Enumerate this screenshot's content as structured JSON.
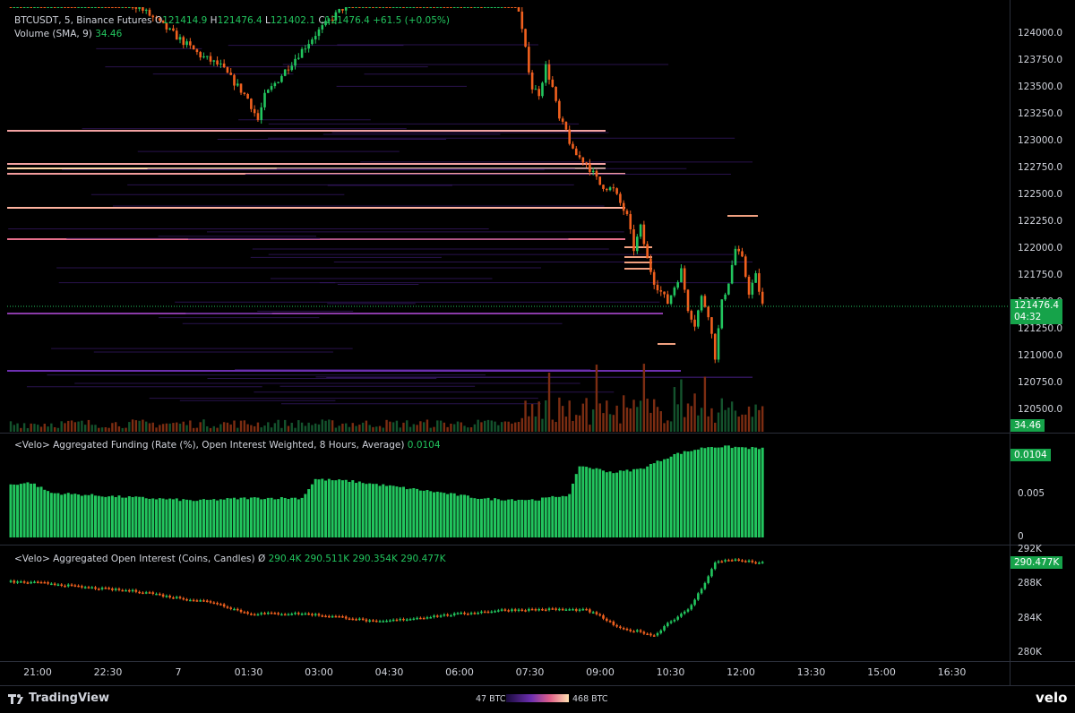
{
  "colors": {
    "up": "#22c55e",
    "down": "#f0601e",
    "background": "#000000",
    "grid": "#2a2e39",
    "last_price_line": "#22c55e"
  },
  "header": {
    "symbol": "BTCUSDT",
    "interval": "5",
    "exchange": "Binance Futures",
    "o_label": "O",
    "o_value": "121414.9",
    "h_label": "H",
    "h_value": "121476.4",
    "l_label": "L",
    "l_value": "121402.1",
    "c_label": "C",
    "c_value": "121476.4",
    "change": "+61.5 (+0.05%)",
    "volume_label": "Volume (SMA, 9)",
    "volume_value": "34.46"
  },
  "funding_panel": {
    "title": "<Velo> Aggregated Funding (Rate (%), Open Interest Weighted, 8 Hours, Average)",
    "value": "0.0104"
  },
  "oi_panel": {
    "title": "<Velo> Aggregated Open Interest (Coins, Candles)",
    "symbol": "Ø",
    "o": "290.4K",
    "h": "290.511K",
    "l": "290.354K",
    "c": "290.477K"
  },
  "price_tags": {
    "last_price": "121476.4",
    "countdown": "04:32",
    "volume": "34.46",
    "funding": "0.0104",
    "oi": "290.477K"
  },
  "heatmap_legend": {
    "min_label": "47 BTC",
    "max_label": "468 BTC"
  },
  "branding": {
    "left": "TradingView",
    "right": "velo"
  },
  "chart_data": [
    {
      "type": "candlestick",
      "title": "BTCUSDT, 5, Binance Futures",
      "ylim": [
        120420,
        124250
      ],
      "y_ticks": [
        "124000.0",
        "123750.0",
        "123500.0",
        "123250.0",
        "123000.0",
        "122750.0",
        "122500.0",
        "122250.0",
        "122000.0",
        "121750.0",
        "121500.0",
        "121250.0",
        "121000.0",
        "120750.0",
        "120500.0"
      ],
      "x_ticks": [
        "21:00",
        "22:30",
        "7",
        "01:30",
        "03:00",
        "04:30",
        "06:00",
        "07:30",
        "09:00",
        "10:30",
        "12:00",
        "13:30",
        "15:00",
        "16:30"
      ],
      "price_path": [
        [
          0,
          124400
        ],
        [
          28,
          124450
        ],
        [
          40,
          124200
        ],
        [
          50,
          123950
        ],
        [
          56,
          123800
        ],
        [
          62,
          123700
        ],
        [
          70,
          123400
        ],
        [
          73,
          123200
        ],
        [
          75,
          123420
        ],
        [
          82,
          123700
        ],
        [
          90,
          124000
        ],
        [
          100,
          124300
        ],
        [
          115,
          124400
        ],
        [
          130,
          124350
        ],
        [
          146,
          124600
        ],
        [
          150,
          124200
        ],
        [
          154,
          123500
        ],
        [
          156,
          123450
        ],
        [
          158,
          123700
        ],
        [
          160,
          123500
        ],
        [
          162,
          123200
        ],
        [
          164,
          123100
        ],
        [
          166,
          122900
        ],
        [
          170,
          122800
        ],
        [
          174,
          122600
        ],
        [
          178,
          122550
        ],
        [
          182,
          122300
        ],
        [
          184,
          122000
        ],
        [
          186,
          122200
        ],
        [
          188,
          121900
        ],
        [
          190,
          121700
        ],
        [
          194,
          121500
        ],
        [
          196,
          121650
        ],
        [
          198,
          121800
        ],
        [
          200,
          121450
        ],
        [
          202,
          121300
        ],
        [
          204,
          121550
        ],
        [
          206,
          121400
        ],
        [
          208,
          121000
        ],
        [
          210,
          121500
        ],
        [
          212,
          121700
        ],
        [
          214,
          122000
        ],
        [
          216,
          121900
        ],
        [
          218,
          121600
        ],
        [
          220,
          121750
        ],
        [
          222,
          121476
        ]
      ],
      "last_price": 121476.4
    },
    {
      "type": "bar",
      "title": "<Velo> Aggregated Funding (Rate (%), Open Interest Weighted, 8 Hours, Average)",
      "ylim": [
        0,
        0.0112
      ],
      "y_ticks": [
        "0.005",
        "0"
      ],
      "values_path": [
        [
          0,
          0.0062
        ],
        [
          6,
          0.0064
        ],
        [
          12,
          0.0052
        ],
        [
          30,
          0.0048
        ],
        [
          55,
          0.0043
        ],
        [
          70,
          0.0046
        ],
        [
          86,
          0.0046
        ],
        [
          90,
          0.0068
        ],
        [
          100,
          0.0066
        ],
        [
          110,
          0.0061
        ],
        [
          126,
          0.0053
        ],
        [
          140,
          0.0045
        ],
        [
          155,
          0.0044
        ],
        [
          165,
          0.005
        ],
        [
          168,
          0.0084
        ],
        [
          178,
          0.0076
        ],
        [
          186,
          0.008
        ],
        [
          196,
          0.0097
        ],
        [
          206,
          0.0106
        ],
        [
          212,
          0.0106
        ],
        [
          221,
          0.0104
        ]
      ]
    },
    {
      "type": "candlestick",
      "title": "<Velo> Aggregated Open Interest (Coins, Candles)",
      "ylim": [
        279700,
        292200
      ],
      "y_ticks": [
        "292K",
        "288K",
        "284K",
        "280K"
      ],
      "oi_path": [
        [
          0,
          288300
        ],
        [
          12,
          288100
        ],
        [
          20,
          287700
        ],
        [
          40,
          287100
        ],
        [
          46,
          286600
        ],
        [
          60,
          285900
        ],
        [
          70,
          284600
        ],
        [
          86,
          284600
        ],
        [
          100,
          284100
        ],
        [
          108,
          283600
        ],
        [
          125,
          284300
        ],
        [
          145,
          285000
        ],
        [
          160,
          285100
        ],
        [
          170,
          285000
        ],
        [
          174,
          284300
        ],
        [
          180,
          282800
        ],
        [
          186,
          282500
        ],
        [
          190,
          282000
        ],
        [
          194,
          283500
        ],
        [
          200,
          285000
        ],
        [
          204,
          287500
        ],
        [
          208,
          290500
        ],
        [
          212,
          290900
        ],
        [
          222,
          290477
        ]
      ]
    }
  ]
}
